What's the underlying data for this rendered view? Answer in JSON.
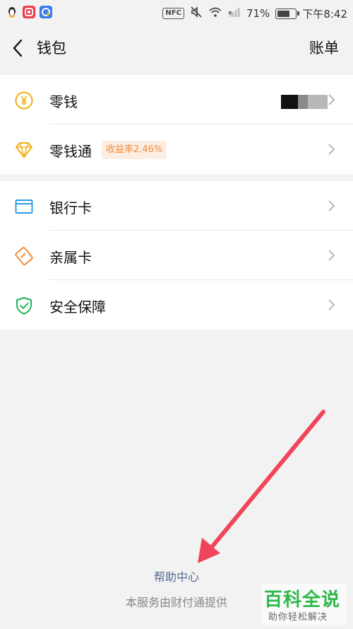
{
  "status_bar": {
    "nfc": "NFC",
    "battery": "71%",
    "battery_level": 0.71,
    "time": "下午8:42"
  },
  "nav": {
    "title": "钱包",
    "right_label": "账单"
  },
  "wallet_items": [
    {
      "label": "零钱",
      "icon": "yuan-coin-icon"
    },
    {
      "label": "零钱通",
      "icon": "diamond-icon",
      "badge": "收益率2.46%"
    }
  ],
  "service_items": [
    {
      "label": "银行卡",
      "icon": "bank-card-icon"
    },
    {
      "label": "亲属卡",
      "icon": "family-card-icon"
    },
    {
      "label": "安全保障",
      "icon": "shield-icon"
    }
  ],
  "footer": {
    "help": "帮助中心",
    "provider": "本服务由财付通提供"
  },
  "watermark": {
    "main": "百科全说",
    "sub": "助你轻松解决"
  },
  "colors": {
    "background": "#f2f2f2",
    "link": "#576b95",
    "badge_text": "#f08a3a",
    "arrow": "#f0445a",
    "watermark": "#2db84b"
  }
}
